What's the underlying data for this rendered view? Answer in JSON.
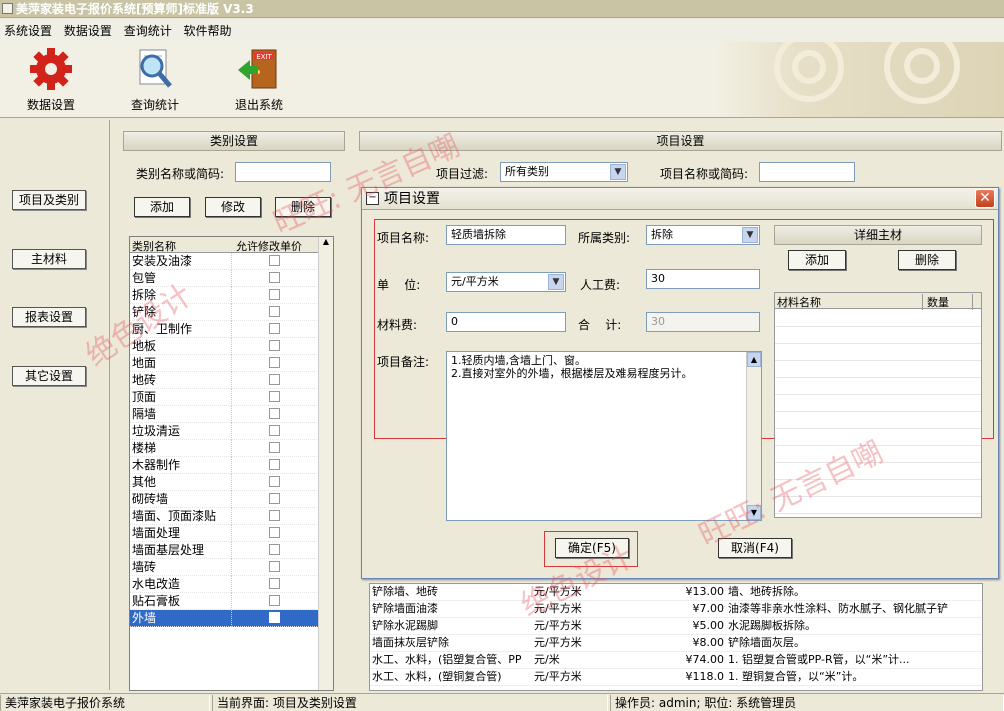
{
  "window": {
    "title": "美萍家装电子报价系统[预算师]标准版 V3.3"
  },
  "menu": [
    "系统设置",
    "数据设置",
    "查询统计",
    "软件帮助"
  ],
  "toolbar": {
    "data_settings": "数据设置",
    "query_stats": "查询统计",
    "exit_system": "退出系统",
    "exit_sign": "EXIT"
  },
  "nav": [
    "项目及类别",
    "主材料",
    "报表设置",
    "其它设置"
  ],
  "category_panel": {
    "title": "类别设置",
    "search_label": "类别名称或简码:",
    "search_value": "",
    "add": "添加",
    "edit": "修改",
    "delete": "删除",
    "col_name": "类别名称",
    "col_allow": "允许修改单价",
    "rows": [
      "安装及油漆",
      "包管",
      "拆除",
      "铲除",
      "厨、卫制作",
      "地板",
      "地面",
      "地砖",
      "顶面",
      "隔墙",
      "垃圾清运",
      "楼梯",
      "木器制作",
      "其他",
      "砌砖墙",
      "墙面、顶面漆贴",
      "墙面处理",
      "墙面基层处理",
      "墙砖",
      "水电改造",
      "贴石膏板",
      "外墙"
    ],
    "selected": "外墙"
  },
  "item_panel": {
    "title": "项目设置",
    "filter_label": "项目过滤:",
    "filter_value": "所有类别",
    "search_label": "项目名称或简码:",
    "rows": [
      {
        "name": "铲除墙、地砖",
        "unit": "元/平方米",
        "price": "¥13.00",
        "note": "墙、地砖拆除。"
      },
      {
        "name": "铲除墙面油漆",
        "unit": "元/平方米",
        "price": "¥7.00",
        "note": "油漆等非亲水性涂料、防水腻子、钢化腻子铲"
      },
      {
        "name": "铲除水泥踢脚",
        "unit": "元/平方米",
        "price": "¥5.00",
        "note": "水泥踢脚板拆除。"
      },
      {
        "name": "墙面抹灰层铲除",
        "unit": "元/平方米",
        "price": "¥8.00",
        "note": "铲除墙面灰层。"
      },
      {
        "name": "水工、水料，(铝塑复合管、PP",
        "unit": "元/米",
        "price": "¥74.00",
        "note": "1. 铝塑复合管或PP-R管，以“米”计..."
      },
      {
        "name": "水工、水料，(塑铜复合管)",
        "unit": "元/平方米",
        "price": "¥118.0",
        "note": "1. 塑铜复合管，以“米”计。"
      }
    ]
  },
  "dialog": {
    "title": "项目设置",
    "close": "✕",
    "name_label": "项目名称:",
    "name_value": "轻质墙拆除",
    "category_label": "所属类别:",
    "category_value": "拆除",
    "unit_label": "单    位:",
    "unit_value": "元/平方米",
    "labor_label": "人工费:",
    "labor_value": "30",
    "material_label": "材料费:",
    "material_value": "0",
    "total_label": "合    计:",
    "total_value": "30",
    "remark_label": "项目备注:",
    "remark_lines": [
      "1.轻质内墙,含墙上门、窗。",
      "2.直接对室外的外墙，根据楼层及难易程度另计。"
    ],
    "main_material": {
      "title": "详细主材",
      "add": "添加",
      "delete": "删除",
      "col_name": "材料名称",
      "col_qty": "数量"
    },
    "ok": "确定(F5)",
    "cancel": "取消(F4)"
  },
  "status": {
    "app": "美萍家装电子报价系统",
    "screen": "当前界面: 项目及类别设置",
    "operator": "操作员: admin; 职位: 系统管理员"
  },
  "watermarks": {
    "a": "旺旺: 无言自嘲",
    "b": "绝色设计",
    "c": "旺旺: 无言自嘲",
    "d": "绝色设计"
  },
  "colors": {
    "selection": "#3169c6",
    "highlight_box": "#d9383a",
    "dialog_close": "#c1421e"
  }
}
